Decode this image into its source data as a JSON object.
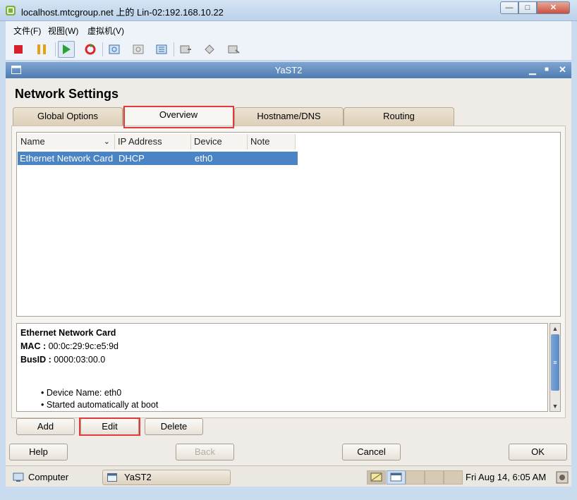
{
  "host": {
    "title": "localhost.mtcgroup.net 上的 Lin-02:192.168.10.22",
    "menu": [
      "文件(F)",
      "视图(W)",
      "虚拟机(V)"
    ],
    "toolbar_icons": [
      "stop-icon",
      "pause-icon",
      "play-icon",
      "reset-icon",
      "snapshot-icon",
      "revert-snapshot-icon",
      "snapshot-manager-icon",
      "fullscreen-icon",
      "quick-switch-icon",
      "summary-view-icon"
    ]
  },
  "yast": {
    "window_title": "YaST2",
    "page_title": "Network Settings",
    "tabs": [
      "Global Options",
      "Overview",
      "Hostname/DNS",
      "Routing"
    ],
    "active_tab": "Overview",
    "table": {
      "columns": [
        "Name",
        "IP Address",
        "Device",
        "Note"
      ],
      "rows": [
        {
          "name": "Ethernet Network Card",
          "ip": "DHCP",
          "device": "eth0",
          "note": ""
        }
      ]
    },
    "details": {
      "heading": "Ethernet Network Card",
      "mac_label": "MAC :",
      "mac_value": "00:0c:29:9c:e5:9d",
      "busid_label": "BusID :",
      "busid_value": "0000:03:00.0",
      "bullets": [
        "Device Name: eth0",
        "Started automatically at boot"
      ]
    },
    "buttons": {
      "add": "Add",
      "edit": "Edit",
      "delete": "Delete",
      "help": "Help",
      "back": "Back",
      "cancel": "Cancel",
      "ok": "OK"
    }
  },
  "taskbar": {
    "computer": "Computer",
    "task": "YaST2",
    "clock": "Fri Aug 14,  6:05 AM"
  },
  "colors": {
    "selection": "#4a84c5",
    "highlight": "#e23a3a",
    "titlebar": "#5f89bd"
  }
}
